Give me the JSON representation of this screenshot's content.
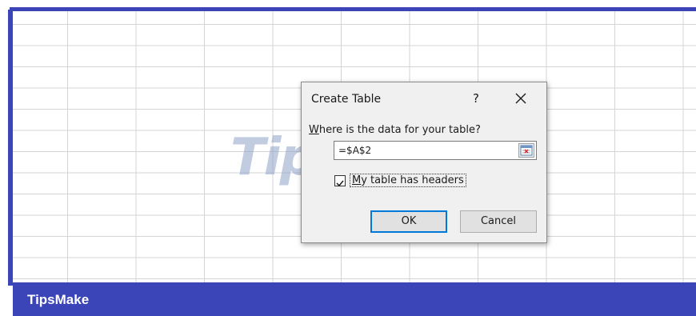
{
  "dialog": {
    "title": "Create Table",
    "help": "?",
    "prompt_prefix": "W",
    "prompt_rest": "here is the data for your table?",
    "range_value": "=$A$2",
    "checkbox_checked": true,
    "checkbox_label_prefix": "M",
    "checkbox_label_rest": "y table has headers",
    "ok_label": "OK",
    "cancel_label": "Cancel"
  },
  "watermark": "TipsMake",
  "footer": {
    "brand": "TipsMake"
  },
  "colors": {
    "frame": "#3b45b8",
    "ok_border": "#0078d7"
  },
  "icons": [
    "close-icon",
    "collapse-dialog-icon",
    "checkmark-icon"
  ]
}
